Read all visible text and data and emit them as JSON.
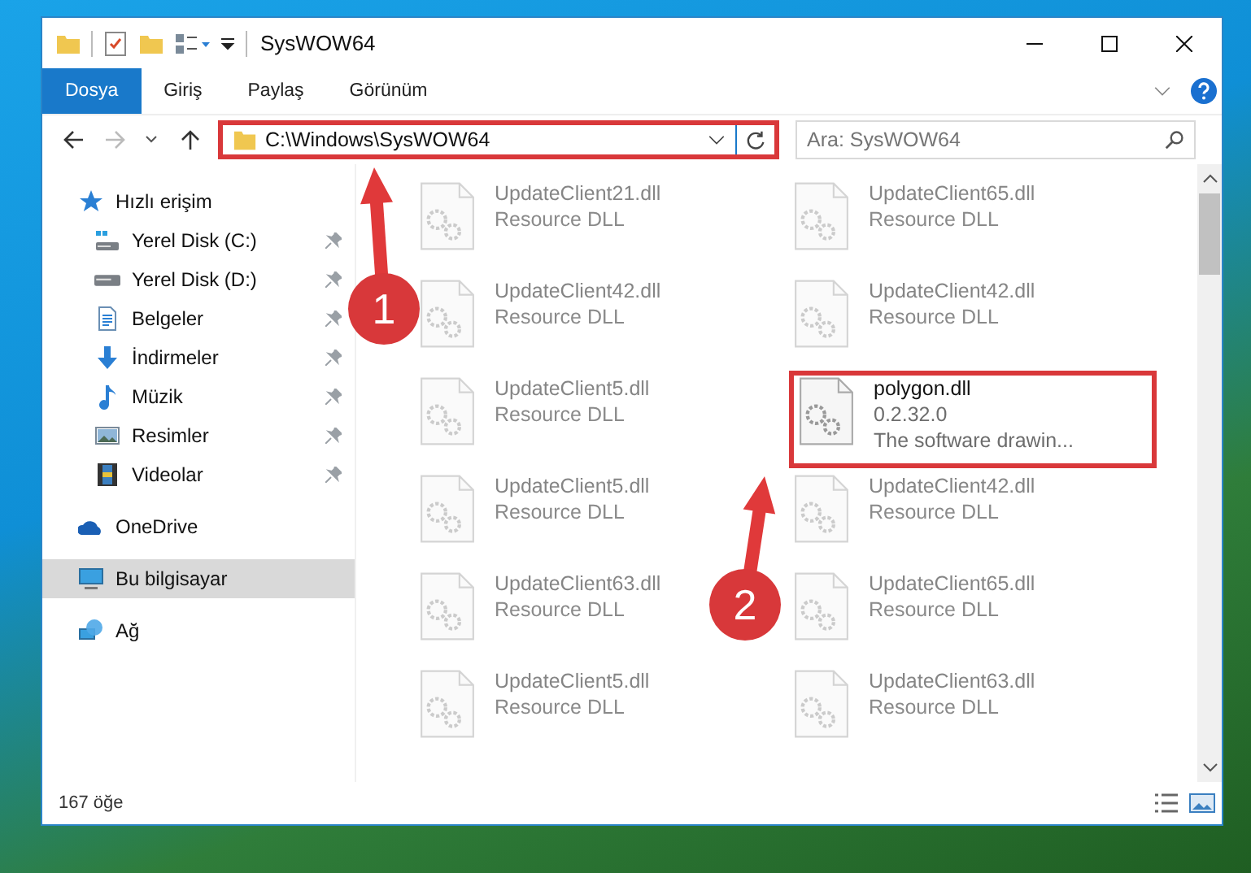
{
  "window": {
    "title": "SysWOW64"
  },
  "ribbon_tabs": [
    {
      "label": "Dosya",
      "selected": true
    },
    {
      "label": "Giriş",
      "selected": false
    },
    {
      "label": "Paylaş",
      "selected": false
    },
    {
      "label": "Görünüm",
      "selected": false
    }
  ],
  "address_bar": {
    "path": "C:\\Windows\\SysWOW64",
    "highlighted": true
  },
  "search": {
    "placeholder": "Ara: SysWOW64"
  },
  "sidebar": {
    "items": [
      {
        "label": "Hızlı erişim",
        "kind": "star",
        "selected": false,
        "children": [
          {
            "label": "Yerel Disk (C:)",
            "kind": "system-drive",
            "pinned": true,
            "selected": false
          },
          {
            "label": "Yerel Disk (D:)",
            "kind": "drive",
            "pinned": true,
            "selected": false
          },
          {
            "label": "Belgeler",
            "kind": "documents",
            "pinned": true,
            "selected": false
          },
          {
            "label": "İndirmeler",
            "kind": "downloads",
            "pinned": true,
            "selected": false
          },
          {
            "label": "Müzik",
            "kind": "music",
            "pinned": true,
            "selected": false
          },
          {
            "label": "Resimler",
            "kind": "pictures",
            "pinned": true,
            "selected": false
          },
          {
            "label": "Videolar",
            "kind": "videos",
            "pinned": true,
            "selected": false
          }
        ]
      },
      {
        "label": "OneDrive",
        "kind": "cloud",
        "selected": false
      },
      {
        "label": "Bu bilgisayar",
        "kind": "computer",
        "selected": true
      },
      {
        "label": "Ağ",
        "kind": "network",
        "selected": false
      }
    ]
  },
  "files": [
    {
      "name": "UpdateClient21.dll",
      "lines": [
        "Resource DLL"
      ],
      "blurred": true,
      "highlighted": false
    },
    {
      "name": "UpdateClient65.dll",
      "lines": [
        "Resource DLL"
      ],
      "blurred": true,
      "highlighted": false
    },
    {
      "name": "UpdateClient42.dll",
      "lines": [
        "Resource DLL"
      ],
      "blurred": true,
      "highlighted": false
    },
    {
      "name": "UpdateClient42.dll",
      "lines": [
        "Resource DLL"
      ],
      "blurred": true,
      "highlighted": false
    },
    {
      "name": "UpdateClient5.dll",
      "lines": [
        "Resource DLL"
      ],
      "blurred": true,
      "highlighted": false
    },
    {
      "name": "polygon.dll",
      "lines": [
        "0.2.32.0",
        "The software drawin..."
      ],
      "blurred": false,
      "highlighted": true
    },
    {
      "name": "UpdateClient5.dll",
      "lines": [
        "Resource DLL"
      ],
      "blurred": true,
      "highlighted": false
    },
    {
      "name": "UpdateClient42.dll",
      "lines": [
        "Resource DLL"
      ],
      "blurred": true,
      "highlighted": false
    },
    {
      "name": "UpdateClient63.dll",
      "lines": [
        "Resource DLL"
      ],
      "blurred": true,
      "highlighted": false
    },
    {
      "name": "UpdateClient65.dll",
      "lines": [
        "Resource DLL"
      ],
      "blurred": true,
      "highlighted": false
    },
    {
      "name": "UpdateClient5.dll",
      "lines": [
        "Resource DLL"
      ],
      "blurred": true,
      "highlighted": false
    },
    {
      "name": "UpdateClient63.dll",
      "lines": [
        "Resource DLL"
      ],
      "blurred": true,
      "highlighted": false
    }
  ],
  "status_bar": {
    "item_count": "167 öğe"
  },
  "callouts": [
    {
      "number": "1"
    },
    {
      "number": "2"
    }
  ]
}
